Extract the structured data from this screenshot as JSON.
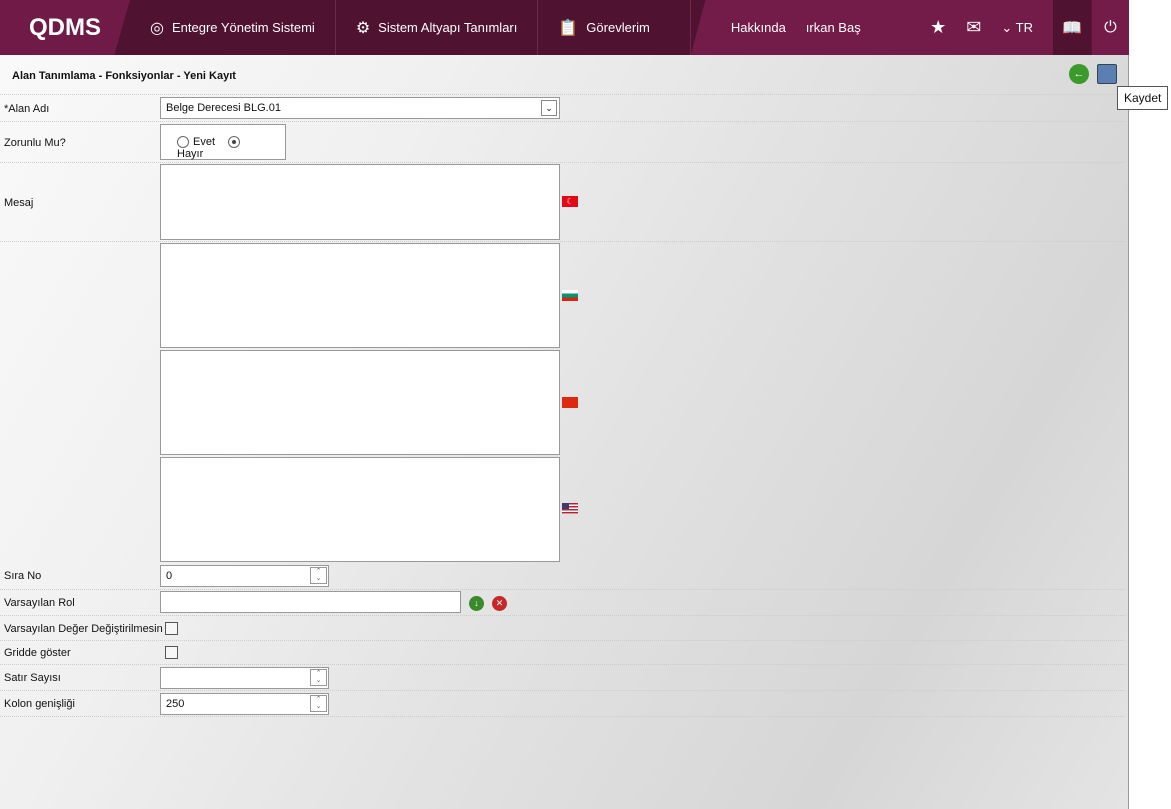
{
  "header": {
    "logo": "QDMS",
    "nav": [
      {
        "label": "Entegre Yönetim Sistemi"
      },
      {
        "label": "Sistem Altyapı Tanımları"
      },
      {
        "label": "Görevlerim"
      }
    ],
    "about": "Hakkında",
    "user": "ırkan Baş",
    "lang": "TR"
  },
  "page": {
    "title": "Alan Tanımlama - Fonksiyonlar - Yeni Kayıt",
    "tooltip": "Kaydet"
  },
  "form": {
    "alan_adi": {
      "label": "*Alan Adı",
      "value": "Belge Derecesi  BLG.01"
    },
    "zorunlu": {
      "label": "Zorunlu Mu?",
      "options": [
        "Evet",
        "Hayır"
      ],
      "selected": "Hayır"
    },
    "mesaj": {
      "label": "Mesaj"
    },
    "sira_no": {
      "label": "Sıra No",
      "value": "0"
    },
    "varsayilan_rol": {
      "label": "Varsayılan Rol",
      "value": ""
    },
    "degistirilmesin": {
      "label": "Varsayılan Değer Değiştirilmesin",
      "checked": false
    },
    "gridde": {
      "label": "Gridde göster",
      "checked": false
    },
    "satir": {
      "label": "Satır Sayısı",
      "value": ""
    },
    "kolon": {
      "label": "Kolon genişliği",
      "value": "250"
    }
  }
}
